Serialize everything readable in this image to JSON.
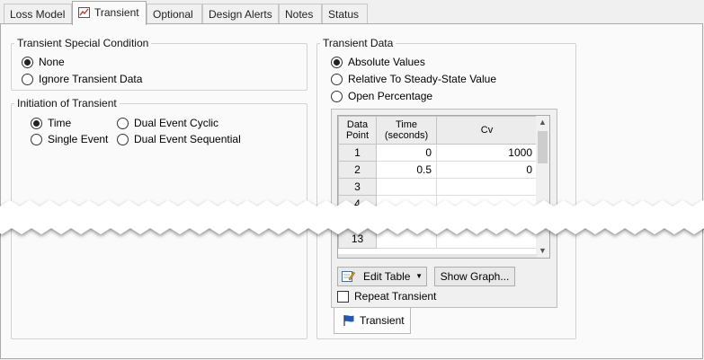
{
  "tabs": [
    {
      "label": "Loss Model",
      "active": false
    },
    {
      "label": "Transient",
      "active": true
    },
    {
      "label": "Optional",
      "active": false
    },
    {
      "label": "Design Alerts",
      "active": false
    },
    {
      "label": "Notes",
      "active": false
    },
    {
      "label": "Status",
      "active": false
    }
  ],
  "special_condition": {
    "title": "Transient Special Condition",
    "options": [
      {
        "label": "None",
        "selected": true
      },
      {
        "label": "Ignore Transient Data",
        "selected": false
      }
    ]
  },
  "initiation": {
    "title": "Initiation of Transient",
    "options": [
      {
        "label": "Time",
        "selected": true
      },
      {
        "label": "Single Event",
        "selected": false
      },
      {
        "label": "Dual Event Cyclic",
        "selected": false
      },
      {
        "label": "Dual Event Sequential",
        "selected": false
      }
    ]
  },
  "transient_data": {
    "title": "Transient Data",
    "options": [
      {
        "label": "Absolute Values",
        "selected": true
      },
      {
        "label": "Relative To Steady-State Value",
        "selected": false
      },
      {
        "label": "Open Percentage",
        "selected": false
      }
    ],
    "table": {
      "headers": {
        "point": "Data Point",
        "time": "Time (seconds)",
        "cv": "Cv"
      },
      "rows": [
        {
          "point": "1",
          "time": "0",
          "cv": "1000"
        },
        {
          "point": "2",
          "time": "0.5",
          "cv": "0"
        },
        {
          "point": "3",
          "time": "",
          "cv": ""
        },
        {
          "point": "4",
          "time": "",
          "cv": ""
        },
        {
          "point": "13",
          "time": "",
          "cv": ""
        }
      ]
    },
    "edit_table_label": "Edit Table",
    "show_graph_label": "Show Graph...",
    "repeat_label": "Repeat Transient",
    "repeat_checked": false,
    "subtab_label": "Transient"
  },
  "colors": {
    "rip": "#ffffff",
    "panel": "#fafafa",
    "accent": "#1e5bb8"
  }
}
